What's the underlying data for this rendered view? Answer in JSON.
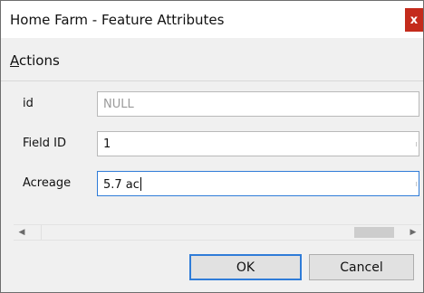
{
  "window": {
    "title": "Home Farm - Feature Attributes",
    "close_glyph": "x",
    "close_color": "#c42b1c"
  },
  "menu": {
    "actions_mnemonic": "A",
    "actions_rest": "ctions"
  },
  "form": {
    "fields": [
      {
        "label": "id",
        "value": "NULL",
        "readonly": true
      },
      {
        "label": "Field ID",
        "value": "1"
      },
      {
        "label": "Acreage",
        "value": "5.7 ac",
        "focused": true
      }
    ]
  },
  "scrollbar": {
    "left_arrow": "◀",
    "right_arrow": "▶"
  },
  "buttons": {
    "ok": "OK",
    "cancel": "Cancel"
  },
  "colors": {
    "focus_accent": "#2f7cd8"
  }
}
